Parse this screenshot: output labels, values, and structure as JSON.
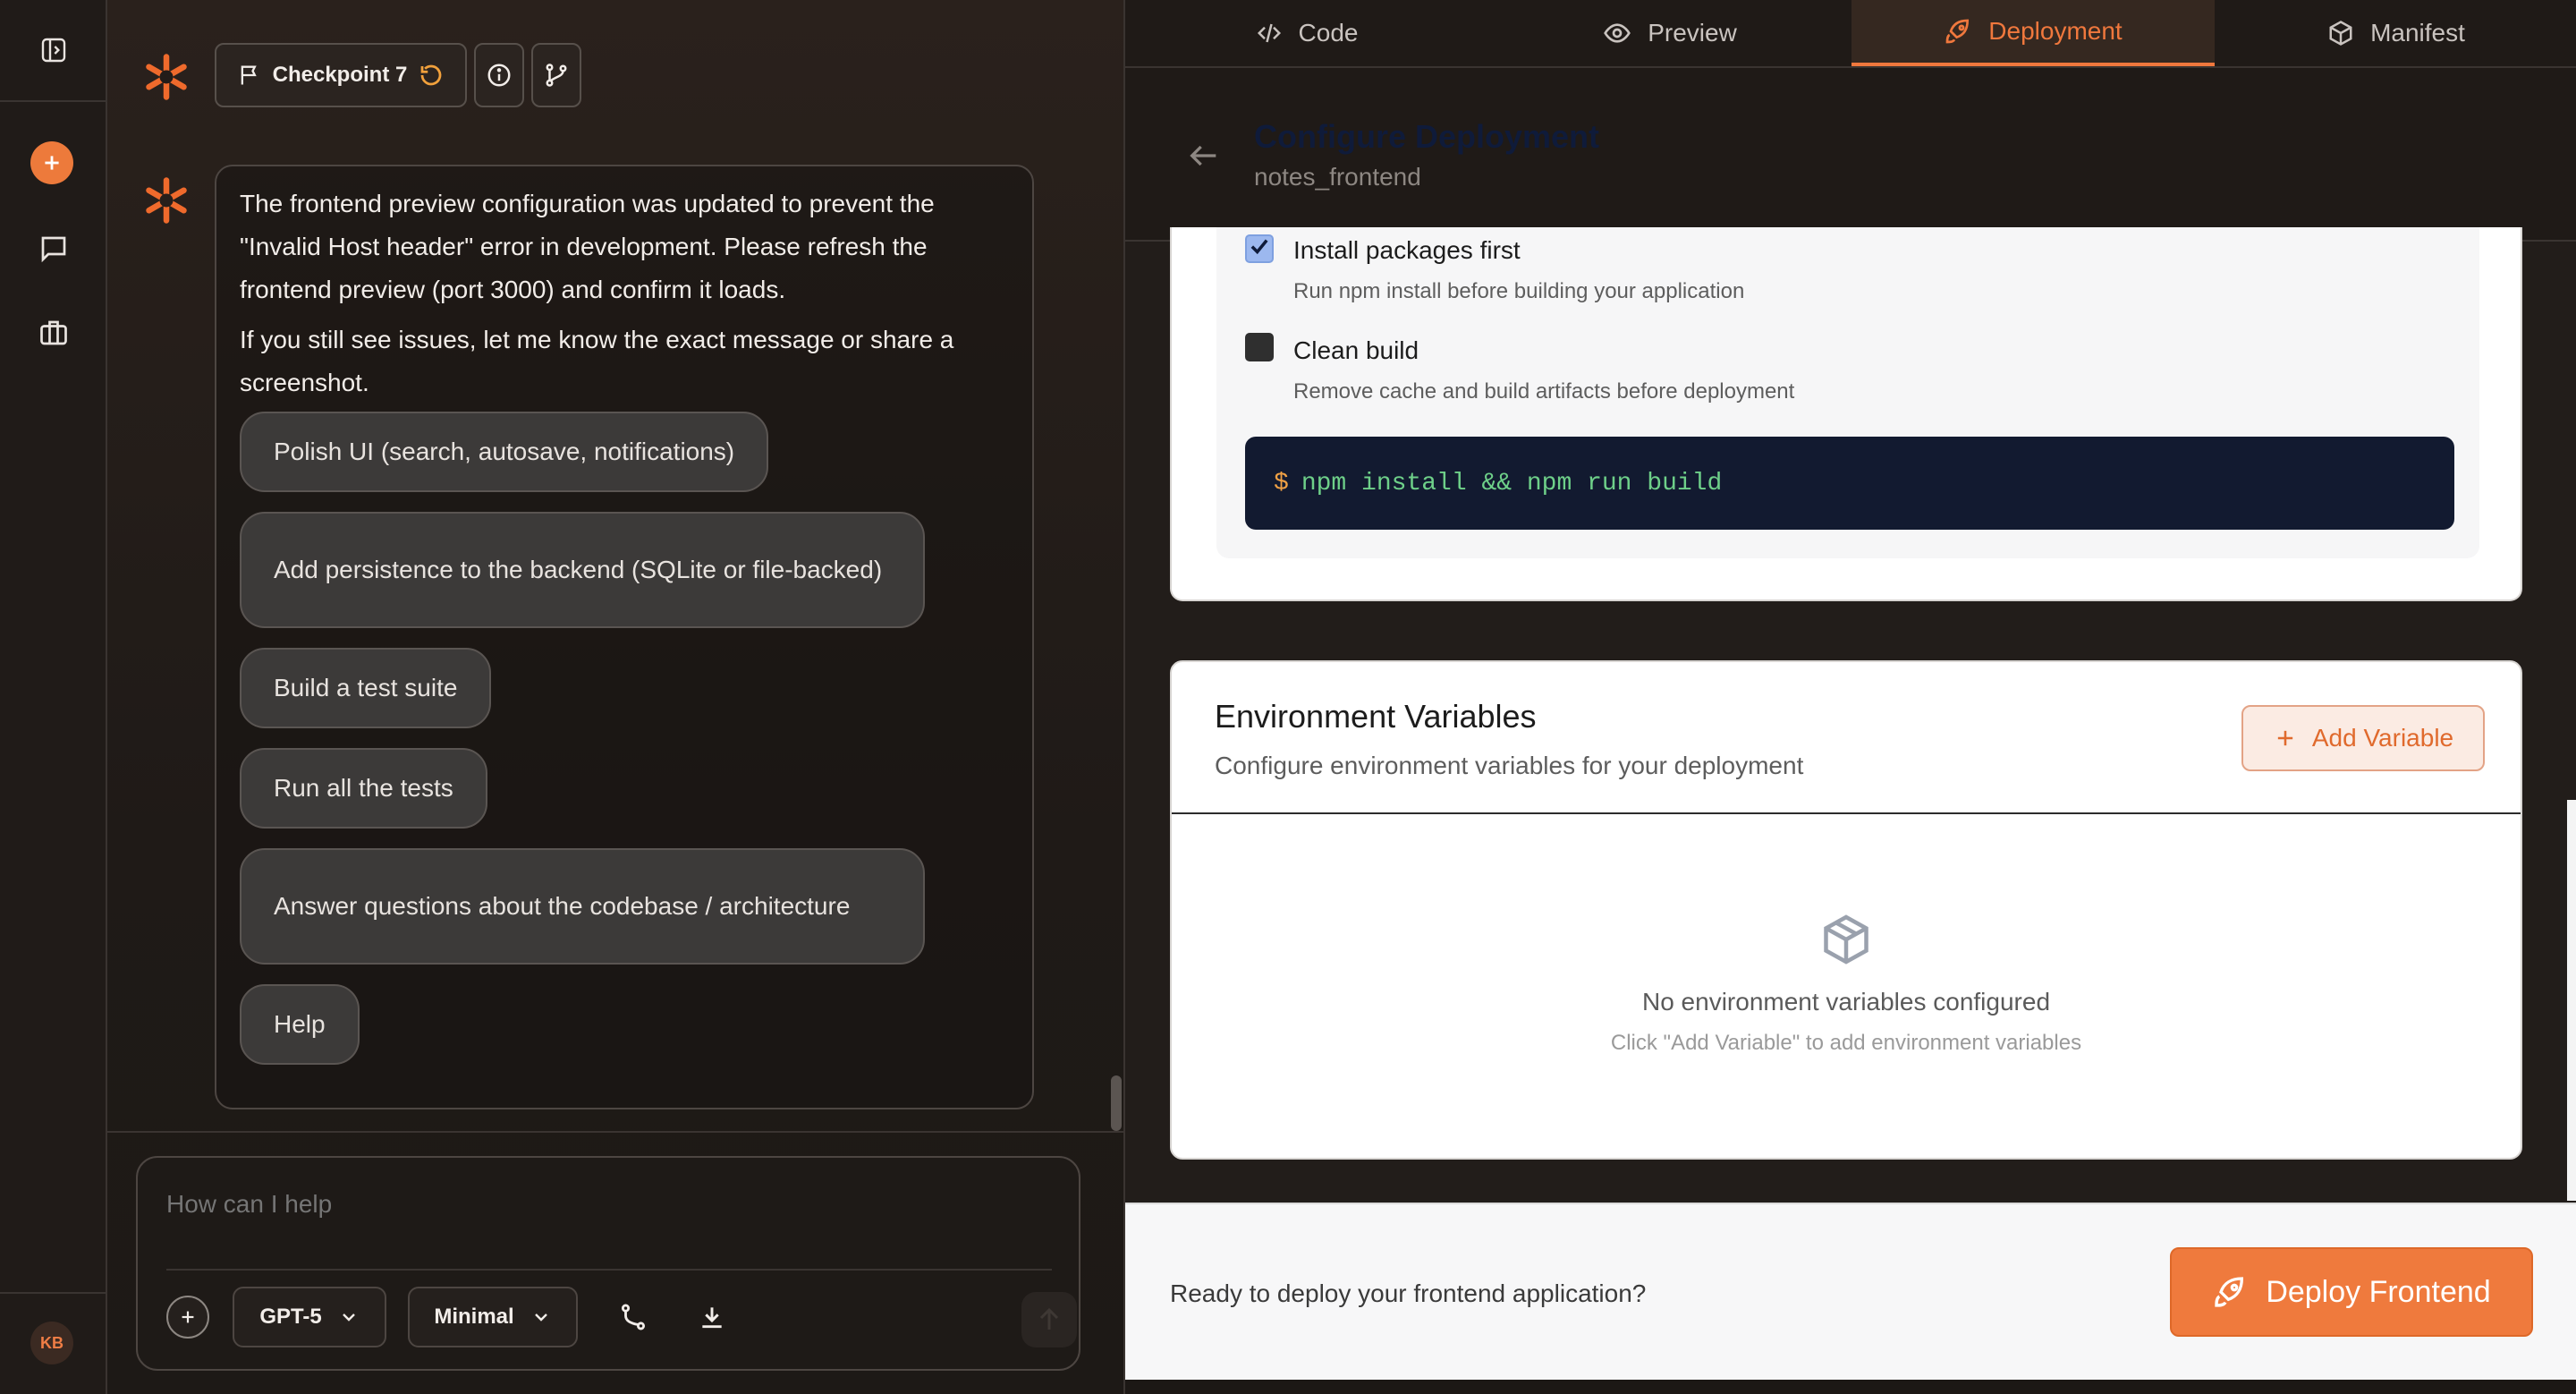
{
  "rail": {
    "user_initials": "KB",
    "icons": [
      "sidebar-toggle-icon",
      "new-chat-icon",
      "chat-icon",
      "briefcase-icon"
    ]
  },
  "chat": {
    "checkpoint_label": "Checkpoint 7",
    "message_paragraphs": [
      "The frontend preview configuration was updated to prevent the \"Invalid Host header\" error in development. Please refresh the frontend preview (port 3000) and confirm it loads.",
      "If you still see issues, let me know the exact message or share a screenshot."
    ],
    "suggestions": [
      "Polish UI (search, autosave, notifications)",
      "Add persistence to the backend (SQLite or file-backed)",
      "Build a test suite",
      "Run all the tests",
      "Answer questions about the codebase / architecture",
      "Help"
    ],
    "composer": {
      "placeholder": "How can I help",
      "model": "GPT-5",
      "reasoning": "Minimal"
    }
  },
  "tabs": [
    {
      "label": "Code",
      "icon": "code-icon",
      "active": false
    },
    {
      "label": "Preview",
      "icon": "eye-icon",
      "active": false
    },
    {
      "label": "Deployment",
      "icon": "rocket-icon",
      "active": true
    },
    {
      "label": "Manifest",
      "icon": "package-icon",
      "active": false
    }
  ],
  "deployment": {
    "title": "Configure Deployment",
    "project": "notes_frontend",
    "options": [
      {
        "title": "Install packages first",
        "desc": "Run npm install before building your application",
        "checked": true
      },
      {
        "title": "Clean build",
        "desc": "Remove cache and build artifacts before deployment",
        "checked": false
      }
    ],
    "command_prompt": "$",
    "command": "npm install && npm run build",
    "env": {
      "title": "Environment Variables",
      "subtitle": "Configure environment variables for your deployment",
      "add_button": "Add Variable",
      "empty_title": "No environment variables configured",
      "empty_subtitle": "Click \"Add Variable\" to add environment variables"
    },
    "footer_text": "Ready to deploy your frontend application?",
    "deploy_button": "Deploy Frontend"
  },
  "colors": {
    "accent": "#f0783d",
    "command_bg": "#121a30",
    "command_text": "#6ed089"
  }
}
